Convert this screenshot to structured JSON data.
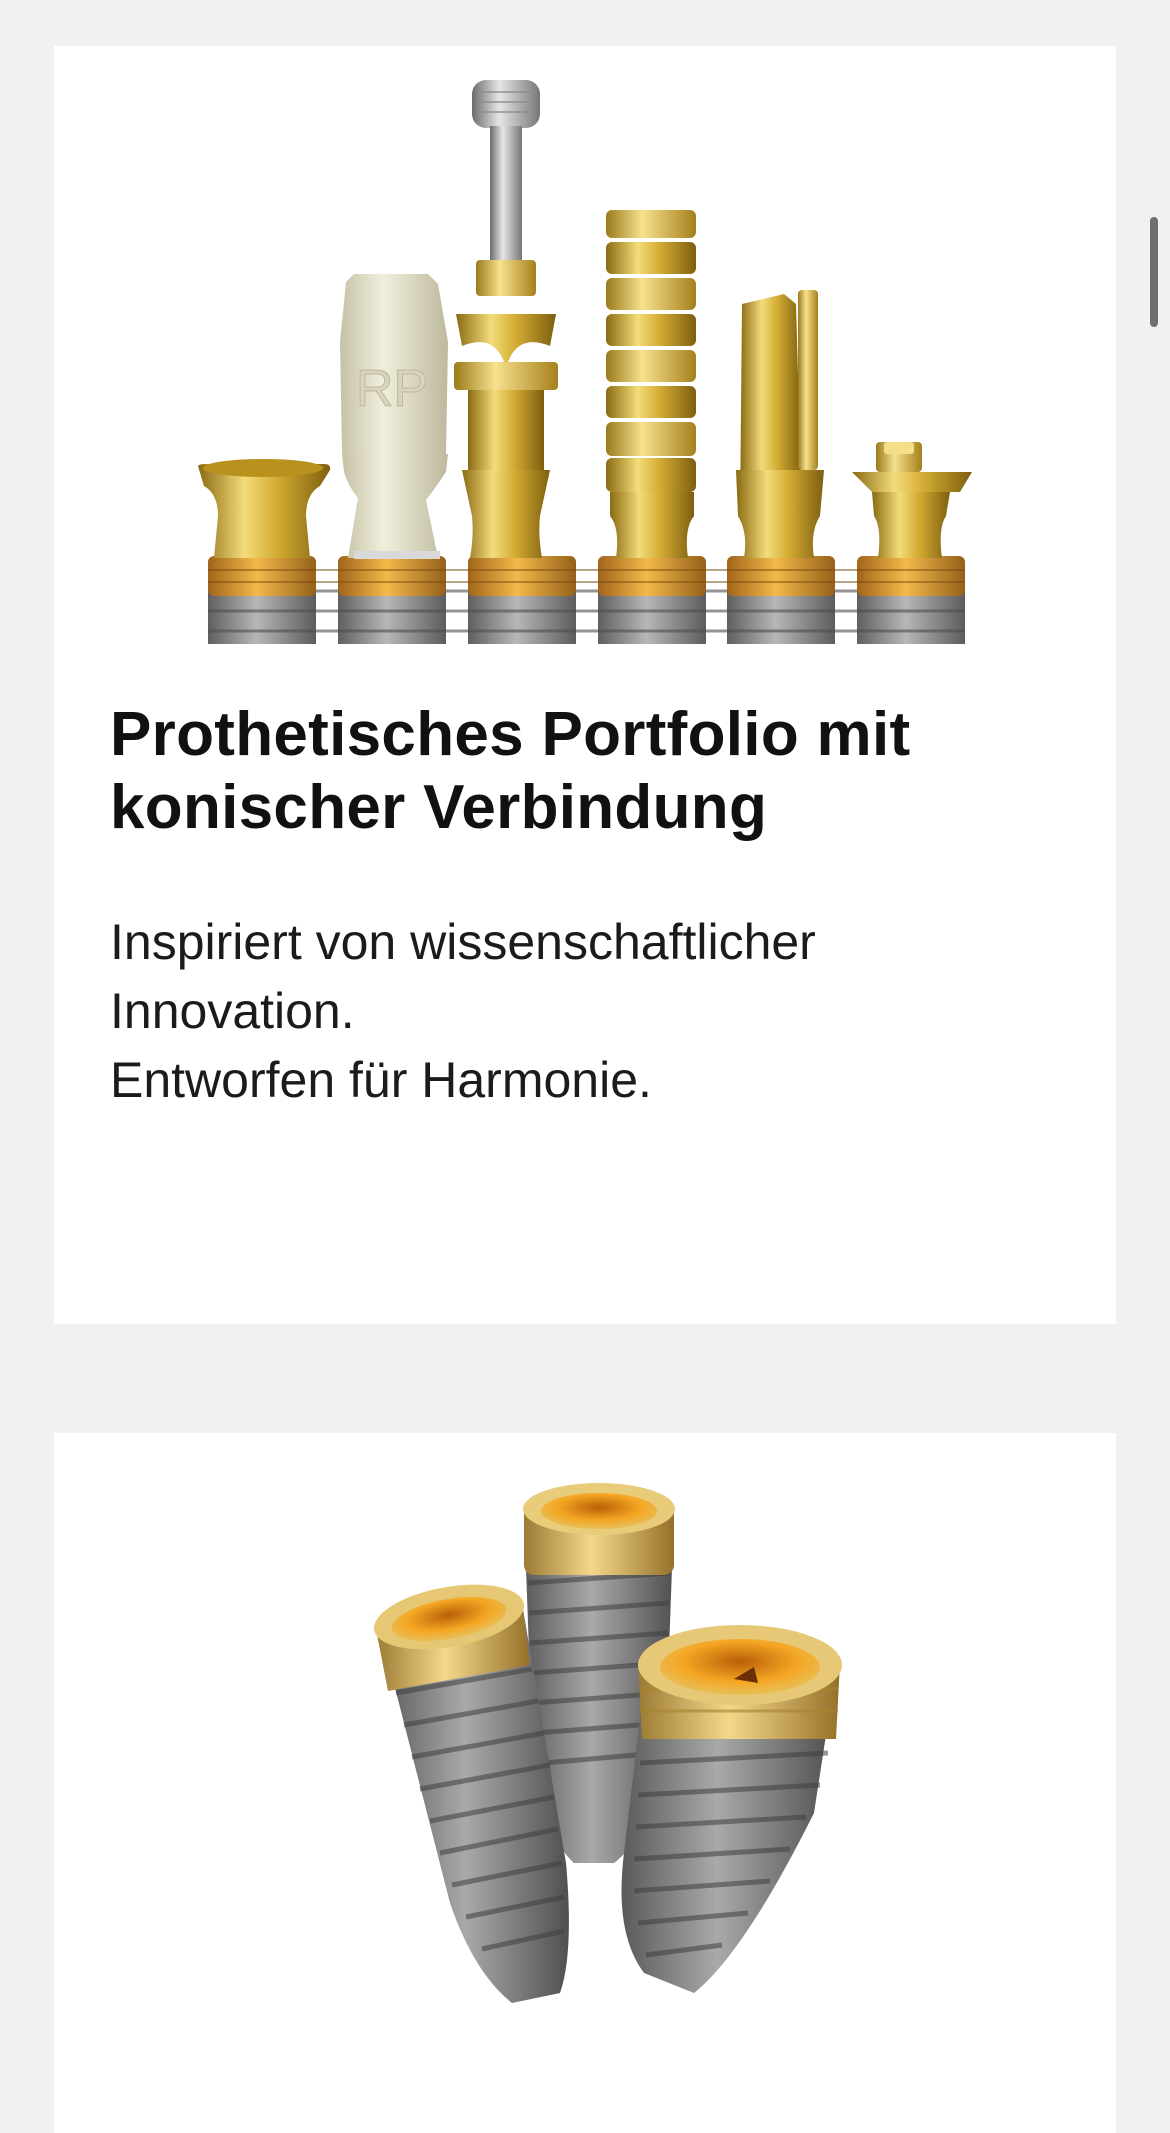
{
  "colors": {
    "page_background": "#f1f1ef",
    "card_background": "#ffffff",
    "gold": "#d7b43e",
    "titanium": "#8f8f8f"
  },
  "cards": [
    {
      "image_subject": "prosthetic-abutments-row",
      "title": "Prothetisches Portfolio mit konischer Verbindung",
      "description_lines": [
        "Inspiriert von wissenschaftlicher",
        "Innovation.",
        "Entworfen für Harmonie."
      ]
    },
    {
      "image_subject": "dental-implants-cluster"
    }
  ]
}
